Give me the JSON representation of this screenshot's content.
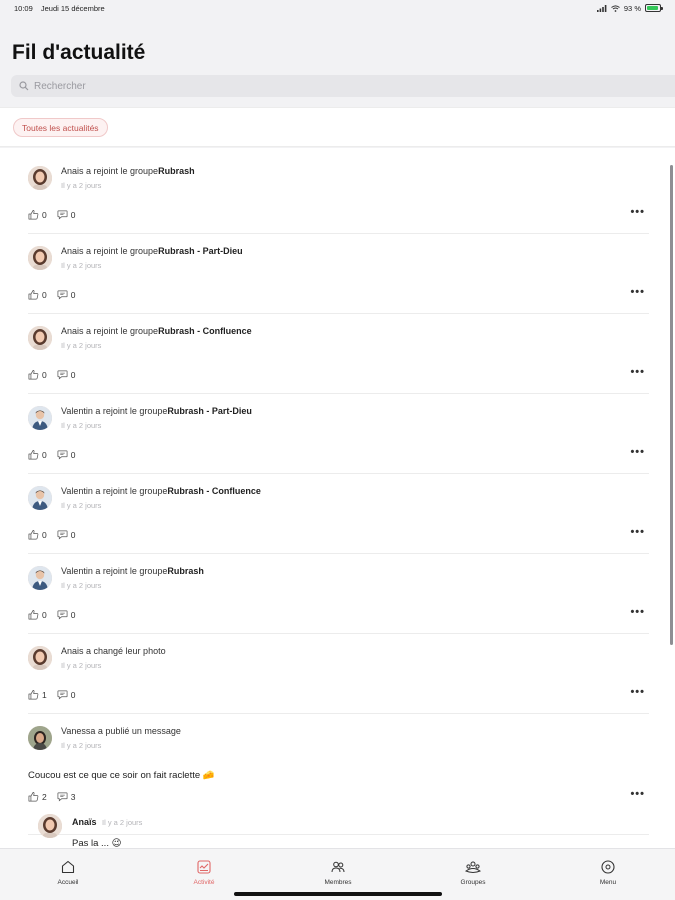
{
  "status_bar": {
    "time": "10:09",
    "date": "Jeudi 15 décembre",
    "battery": "93 %",
    "battery_level": 0.93
  },
  "header": {
    "title": "Fil d'actualité"
  },
  "search": {
    "placeholder": "Rechercher"
  },
  "filter": {
    "label": "Toutes les actualités"
  },
  "posts": [
    {
      "author": "Anais",
      "action": " a rejoint le groupe",
      "target": "Rubrash",
      "time": "Il y a 2 jours",
      "likes": "0",
      "comments": "0",
      "avatar": "avatar-female"
    },
    {
      "author": "Anais",
      "action": " a rejoint le groupe",
      "target": "Rubrash - Part-Dieu",
      "time": "Il y a 2 jours",
      "likes": "0",
      "comments": "0",
      "avatar": "avatar-female"
    },
    {
      "author": "Anais",
      "action": " a rejoint le groupe",
      "target": "Rubrash - Confluence",
      "time": "Il y a 2 jours",
      "likes": "0",
      "comments": "0",
      "avatar": "avatar-female"
    },
    {
      "author": "Valentin",
      "action": " a rejoint le groupe",
      "target": "Rubrash - Part-Dieu",
      "time": "Il y a 2 jours",
      "likes": "0",
      "comments": "0",
      "avatar": "avatar-male"
    },
    {
      "author": "Valentin",
      "action": " a rejoint le groupe",
      "target": "Rubrash - Confluence",
      "time": "Il y a 2 jours",
      "likes": "0",
      "comments": "0",
      "avatar": "avatar-male"
    },
    {
      "author": "Valentin",
      "action": " a rejoint le groupe",
      "target": "Rubrash",
      "time": "Il y a 2 jours",
      "likes": "0",
      "comments": "0",
      "avatar": "avatar-male"
    },
    {
      "author": "Anais",
      "action": " a changé leur photo",
      "target": "",
      "time": "Il y a 2 jours",
      "likes": "1",
      "comments": "0",
      "avatar": "avatar-female"
    },
    {
      "author": "Vanessa",
      "action": " a publié un message",
      "target": "",
      "time": "Il y a 2 jours",
      "message": "Coucou est ce que ce soir on fait raclette 🧀",
      "likes": "2",
      "comments": "3",
      "avatar": "avatar-vanessa"
    }
  ],
  "comment": {
    "author": "Anaïs",
    "time": "Il y a 2 jours",
    "text": "Pas la ... 😉"
  },
  "tabs": [
    {
      "label": "Accueil",
      "icon": "home-icon",
      "active": false
    },
    {
      "label": "Activité",
      "icon": "activity-icon",
      "active": true
    },
    {
      "label": "Membres",
      "icon": "members-icon",
      "active": false
    },
    {
      "label": "Groupes",
      "icon": "groups-icon",
      "active": false
    },
    {
      "label": "Menu",
      "icon": "menu-icon",
      "active": false
    }
  ],
  "colors": {
    "accent": "#e06666",
    "pill_bg": "#fdf2f2"
  }
}
